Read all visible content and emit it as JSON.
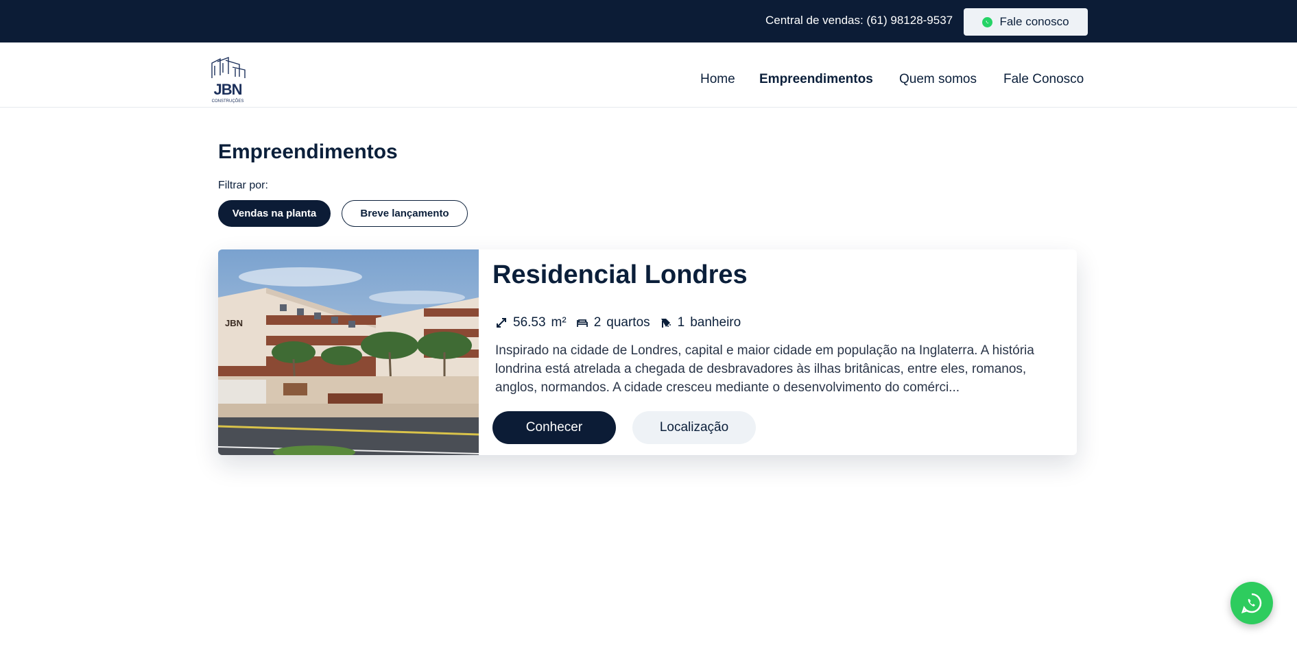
{
  "topbar": {
    "phone_text": "Central de vendas: (61) 98128-9537",
    "contact_button": "Fale conosco",
    "contact_icon": "whatsapp-icon"
  },
  "header": {
    "logo_text": "JBN",
    "logo_subtext": "CONSTRUÇÕES",
    "nav": [
      {
        "label": "Home",
        "active": false
      },
      {
        "label": "Empreendimentos",
        "active": true
      },
      {
        "label": "Quem somos",
        "active": false
      },
      {
        "label": "Fale Conosco",
        "active": false
      }
    ]
  },
  "main": {
    "title": "Empreendimentos",
    "filter_label": "Filtrar por:",
    "filters": [
      {
        "label": "Vendas na planta",
        "selected": true
      },
      {
        "label": "Breve lançamento",
        "selected": false
      }
    ]
  },
  "listing": {
    "title": "Residencial Londres",
    "area_value": "56.53",
    "area_unit": "m²",
    "rooms_value": "2",
    "rooms_label": "quartos",
    "bath_value": "1",
    "bath_label": "banheiro",
    "description": "Inspirado na cidade de Londres, capital e maior cidade em população na Inglaterra. A história londrina está atrelada a chegada de desbravadores às ilhas britânicas, entre eles, romanos, anglos, normandos. A cidade cresceu mediante o desenvolvimento do comérci...",
    "primary_button": "Conhecer",
    "secondary_button": "Localização"
  },
  "colors": {
    "navy": "#0c1c36",
    "light": "#eef2f6",
    "whatsapp": "#2ecc5e"
  }
}
